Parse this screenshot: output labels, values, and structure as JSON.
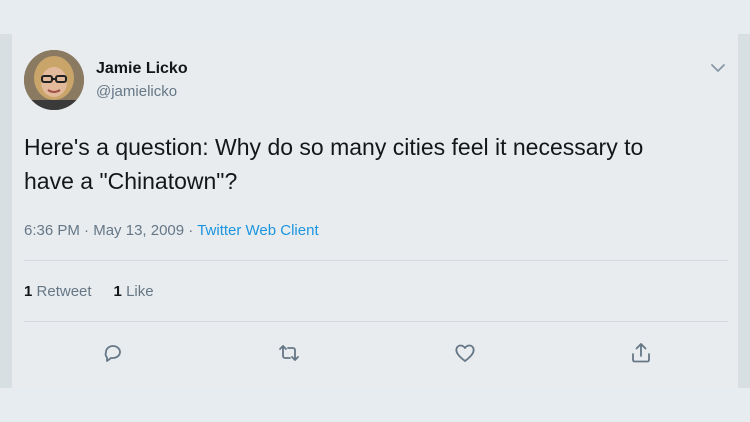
{
  "tweet": {
    "author_name": "Jamie Licko",
    "author_handle": "@jamielicko",
    "text": "Here's a question: Why do so many cities feel it necessary to have a \"Chinatown\"?",
    "time": "6:36 PM",
    "date": "May 13, 2009",
    "separator": " · ",
    "client": "Twitter Web Client",
    "retweet_count": "1",
    "retweet_label": "Retweet",
    "like_count": "1",
    "like_label": "Like"
  },
  "icons": {
    "menu": "chevron-down-icon",
    "reply": "reply-icon",
    "retweet": "retweet-icon",
    "like": "heart-icon",
    "share": "share-icon"
  },
  "colors": {
    "link": "#1b95e0",
    "muted": "#657786",
    "text": "#14171a"
  }
}
